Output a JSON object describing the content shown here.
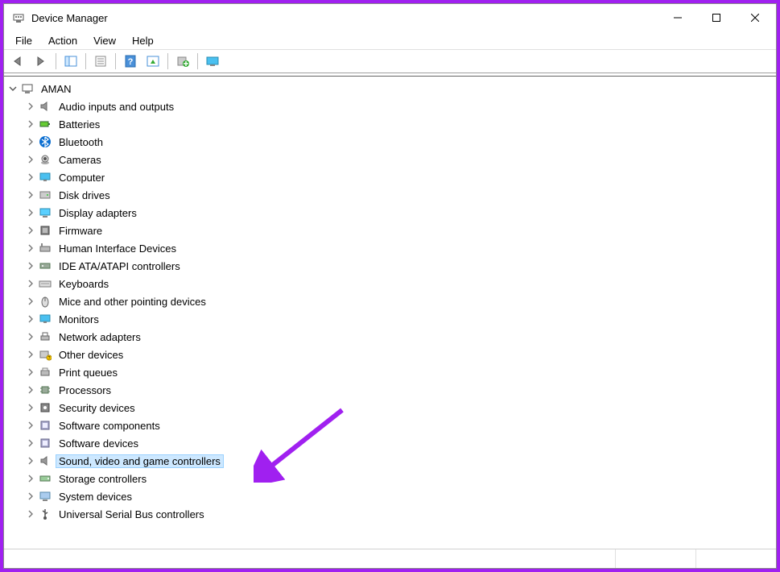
{
  "window": {
    "title": "Device Manager"
  },
  "menubar": [
    "File",
    "Action",
    "View",
    "Help"
  ],
  "toolbar": [
    "back-icon",
    "forward-icon",
    "|",
    "show-hide-tree-icon",
    "|",
    "properties-icon",
    "|",
    "help-icon",
    "update-driver-icon",
    "|",
    "uninstall-icon",
    "|",
    "scan-hardware-icon"
  ],
  "tree": {
    "root": {
      "label": "AMAN",
      "icon": "computer-icon",
      "expanded": true
    },
    "children": [
      {
        "label": "Audio inputs and outputs",
        "icon": "speaker-icon"
      },
      {
        "label": "Batteries",
        "icon": "battery-icon"
      },
      {
        "label": "Bluetooth",
        "icon": "bluetooth-icon"
      },
      {
        "label": "Cameras",
        "icon": "camera-icon"
      },
      {
        "label": "Computer",
        "icon": "monitor-icon"
      },
      {
        "label": "Disk drives",
        "icon": "disk-icon"
      },
      {
        "label": "Display adapters",
        "icon": "display-icon"
      },
      {
        "label": "Firmware",
        "icon": "firmware-icon"
      },
      {
        "label": "Human Interface Devices",
        "icon": "hid-icon"
      },
      {
        "label": "IDE ATA/ATAPI controllers",
        "icon": "ide-icon"
      },
      {
        "label": "Keyboards",
        "icon": "keyboard-icon"
      },
      {
        "label": "Mice and other pointing devices",
        "icon": "mouse-icon"
      },
      {
        "label": "Monitors",
        "icon": "monitor-icon"
      },
      {
        "label": "Network adapters",
        "icon": "network-icon"
      },
      {
        "label": "Other devices",
        "icon": "other-icon"
      },
      {
        "label": "Print queues",
        "icon": "printer-icon"
      },
      {
        "label": "Processors",
        "icon": "cpu-icon"
      },
      {
        "label": "Security devices",
        "icon": "security-icon"
      },
      {
        "label": "Software components",
        "icon": "software-icon"
      },
      {
        "label": "Software devices",
        "icon": "software-icon"
      },
      {
        "label": "Sound, video and game controllers",
        "icon": "speaker-icon",
        "selected": true
      },
      {
        "label": "Storage controllers",
        "icon": "storage-icon"
      },
      {
        "label": "System devices",
        "icon": "system-icon"
      },
      {
        "label": "Universal Serial Bus controllers",
        "icon": "usb-icon"
      }
    ]
  },
  "annotation": {
    "color": "#a020f0"
  }
}
